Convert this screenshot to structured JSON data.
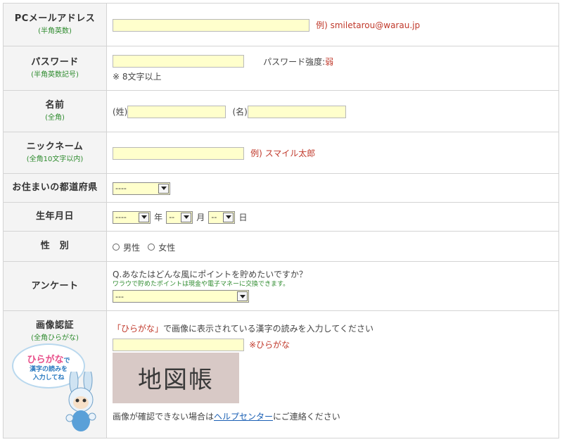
{
  "rows": {
    "email": {
      "label": "PCメールアドレス",
      "sub": "(半角英数)",
      "example": "例) smiletarou@warau.jp"
    },
    "password": {
      "label": "パスワード",
      "sub": "(半角英数記号)",
      "strength_label": "パスワード強度:",
      "strength_value": "弱",
      "note": "※ 8文字以上"
    },
    "name": {
      "label": "名前",
      "sub": "(全角)",
      "last": "(姓)",
      "first": "(名)"
    },
    "nickname": {
      "label": "ニックネーム",
      "sub": "(全角10文字以内)",
      "example": "例) スマイル太郎"
    },
    "prefecture": {
      "label": "お住まいの都道府県",
      "selected": "----"
    },
    "birthday": {
      "label": "生年月日",
      "year_value": "----",
      "year_unit": "年",
      "month_value": "--",
      "month_unit": "月",
      "day_value": "--",
      "day_unit": "日"
    },
    "gender": {
      "label": "性　別",
      "male": "男性",
      "female": "女性"
    },
    "survey": {
      "label": "アンケート",
      "question": "Q.あなたはどんな風にポイントを貯めたいですか？",
      "note": "ワラウで貯めたポイントは現金や電子マネーに交換できます。",
      "selected": "---"
    },
    "captcha": {
      "label": "画像認証",
      "sub": "(全角ひらがな)",
      "instruction_q": "「ひらがな」",
      "instruction_rest": "で画像に表示されている漢字の読みを入力してください",
      "hint": "※ひらがな",
      "image_text": "地図帳",
      "help_pre": "画像が確認できない場合は",
      "help_link": "ヘルプセンター",
      "help_post": "にご連絡ください",
      "mascot_big": "ひらがな",
      "mascot_de": "で",
      "mascot_line2": "漢字の読みを",
      "mascot_line3": "入力してね"
    }
  },
  "colors": {
    "input_bg": "#ffffcc",
    "label_bg": "#f4f4f4",
    "sub_green": "#2e8b2e",
    "example_red": "#c0392b",
    "link_blue": "#1a5fb4"
  },
  "icons": [
    "chevron-down-icon",
    "radio-icon",
    "mascot-rabbit-icon"
  ]
}
